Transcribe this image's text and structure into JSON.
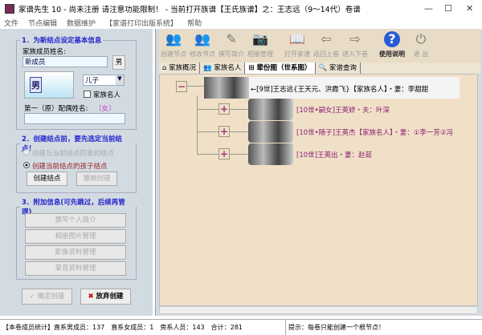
{
  "window": {
    "title": "家谱先生 10 - 尚未注册 请注意功能限制！ - 当前打开族谱【王氏族谱】之：王志远（9～14代）卷谱"
  },
  "menu": [
    "文件",
    "节点编辑",
    "数据维护",
    "【家谱打印出版系统】",
    "帮助"
  ],
  "left": {
    "section1": {
      "legend": "1．为新结点设定基本信息",
      "name_label": "家族成员姓名:",
      "name_value": "新成员",
      "gender_button": "男",
      "gender_avatar": "男",
      "relation_value": "儿子",
      "famous_label": "家族名人",
      "famous_checked": false,
      "spouse_label": "第一（原）配偶姓名:",
      "spouse_gender": "〔女〕",
      "spouse_value": ""
    },
    "section2": {
      "legend": "2．创建结点前，要先选定当前结点！",
      "radio1": "创建与当前结点同辈的结点",
      "radio2": "创建当前结点的孩子结点",
      "selected": "radio2",
      "create_button": "创建结点",
      "undo_button": "撤销创建"
    },
    "section3": {
      "legend": "3．附加信息(可先跳过，后续再管理)",
      "buttons": [
        "撰写个人简介",
        "相册图片管理",
        "影像资料管理",
        "录音资料管理"
      ]
    },
    "confirm_button": "确定创建",
    "abandon_button": "放弃创建"
  },
  "toolbar": [
    {
      "label": "创建节点",
      "icon": "people-add-icon"
    },
    {
      "label": "修改节点",
      "icon": "people-edit-icon"
    },
    {
      "label": "撰写简介",
      "icon": "pen-icon"
    },
    {
      "label": "相册管理",
      "icon": "camera-icon"
    },
    {
      "label": "打开家谱",
      "icon": "book-icon"
    },
    {
      "label": "返回上卷",
      "icon": "arrow-left-icon"
    },
    {
      "label": "进入下卷",
      "icon": "arrow-right-icon"
    },
    {
      "label": "使用说明",
      "icon": "help-icon"
    },
    {
      "label": "退  出",
      "icon": "power-icon"
    }
  ],
  "tabs": [
    {
      "label": "家族概况",
      "icon": "house-icon"
    },
    {
      "label": "家族名人",
      "icon": "people-icon"
    },
    {
      "label": "辈份图（世系图）",
      "icon": "tree-icon",
      "active": true
    },
    {
      "label": "家谱查询",
      "icon": "search-icon"
    }
  ],
  "tree": {
    "root": "←[9世]王志远{王天元、洪霞飞}【家族名人】・妻：李甜甜",
    "children": [
      "[10世•嗣女]王英娇・夫：叶深",
      "[10世•随子]王英杰【家族名人】・妻：①李一芳②冯",
      "[10世]王英出・妻：赵茹"
    ]
  },
  "status": {
    "stats": "【本卷成员统计】直系男成员：137　直系女成员：1　旁系人员：143　合计：281",
    "hint": "提示：每卷只能创建一个根节点！"
  }
}
